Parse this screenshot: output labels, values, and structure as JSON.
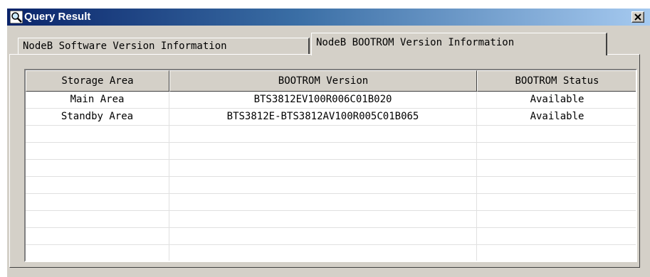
{
  "window": {
    "title": "Query Result",
    "title_icon": "magnifier-icon",
    "close_icon": "close-icon"
  },
  "tabs": [
    {
      "label": "NodeB Software Version Information",
      "active": false
    },
    {
      "label": "NodeB BOOTROM Version Information",
      "active": true
    }
  ],
  "table": {
    "columns": [
      "Storage Area",
      "BOOTROM Version",
      "BOOTROM Status"
    ],
    "rows": [
      [
        "Main Area",
        "BTS3812EV100R006C01B020",
        "Available"
      ],
      [
        "Standby Area",
        "BTS3812E-BTS3812AV100R005C01B065",
        "Available"
      ],
      [
        "",
        "",
        ""
      ],
      [
        "",
        "",
        ""
      ],
      [
        "",
        "",
        ""
      ],
      [
        "",
        "",
        ""
      ],
      [
        "",
        "",
        ""
      ],
      [
        "",
        "",
        ""
      ],
      [
        "",
        "",
        ""
      ],
      [
        "",
        "",
        ""
      ]
    ]
  },
  "colors": {
    "title_gradient_start": "#0a246a",
    "title_gradient_end": "#a6caf0",
    "face": "#d4d0c8"
  }
}
